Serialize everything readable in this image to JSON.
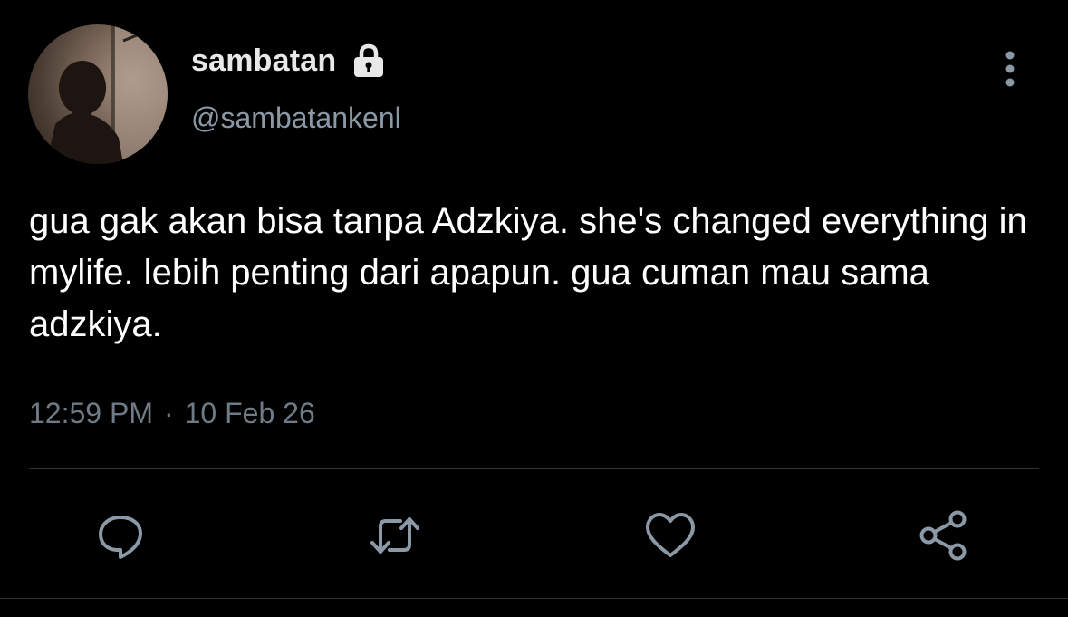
{
  "user": {
    "display_name": "sambatan",
    "handle": "@sambatankenl",
    "protected_icon": "lock-icon",
    "avatar": "profile-photo"
  },
  "tweet": {
    "text": "gua gak akan bisa tanpa Adzkiya. she's changed everything in mylife. lebih penting dari apapun. gua cuman mau sama adzkiya.",
    "time": "12:59 PM",
    "separator": "·",
    "date": "10 Feb 26"
  },
  "actions": [
    {
      "icon": "reply-icon"
    },
    {
      "icon": "retweet-icon"
    },
    {
      "icon": "like-icon"
    },
    {
      "icon": "share-icon"
    }
  ],
  "menu_icon": "more-vertical-icon",
  "colors": {
    "background": "#000000",
    "text_primary": "#ffffff",
    "text_secondary": "#8b98a5",
    "icon": "#8b98a5",
    "divider": "#2f3336"
  }
}
